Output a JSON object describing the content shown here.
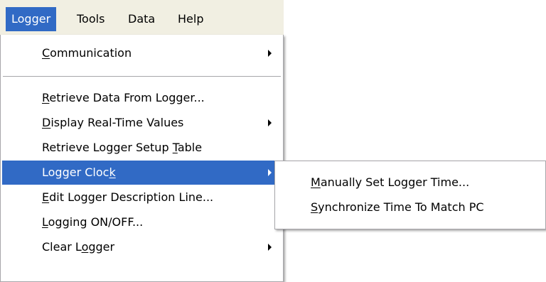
{
  "menubar": {
    "items": [
      "Logger",
      "Tools",
      "Data",
      "Help"
    ],
    "active": "Logger"
  },
  "logger_menu": {
    "items": [
      {
        "pre": "",
        "key": "C",
        "post": "ommunication",
        "submenu": true
      },
      {
        "pre": "",
        "key": "R",
        "post": "etrieve Data From Logger...",
        "submenu": false
      },
      {
        "pre": "",
        "key": "D",
        "post": "isplay Real-Time Values",
        "submenu": true
      },
      {
        "pre": "Retrieve Logger Setup ",
        "key": "T",
        "post": "able",
        "submenu": false
      },
      {
        "pre": "Logger Cloc",
        "key": "k",
        "post": "",
        "submenu": true,
        "highlighted": true
      },
      {
        "pre": "",
        "key": "E",
        "post": "dit Logger Description Line...",
        "submenu": false
      },
      {
        "pre": "",
        "key": "L",
        "post": "ogging ON/OFF...",
        "submenu": false
      },
      {
        "pre": "Clear L",
        "key": "o",
        "post": "gger",
        "submenu": true
      }
    ]
  },
  "clock_submenu": {
    "items": [
      {
        "pre": "",
        "key": "M",
        "post": "anually Set Logger Time..."
      },
      {
        "pre": "",
        "key": "S",
        "post": "ynchronize Time To Match PC"
      }
    ]
  },
  "colors": {
    "highlight": "#316ac5",
    "menubar_bg": "#f1efe2",
    "menu_border": "#a7a6aa"
  }
}
